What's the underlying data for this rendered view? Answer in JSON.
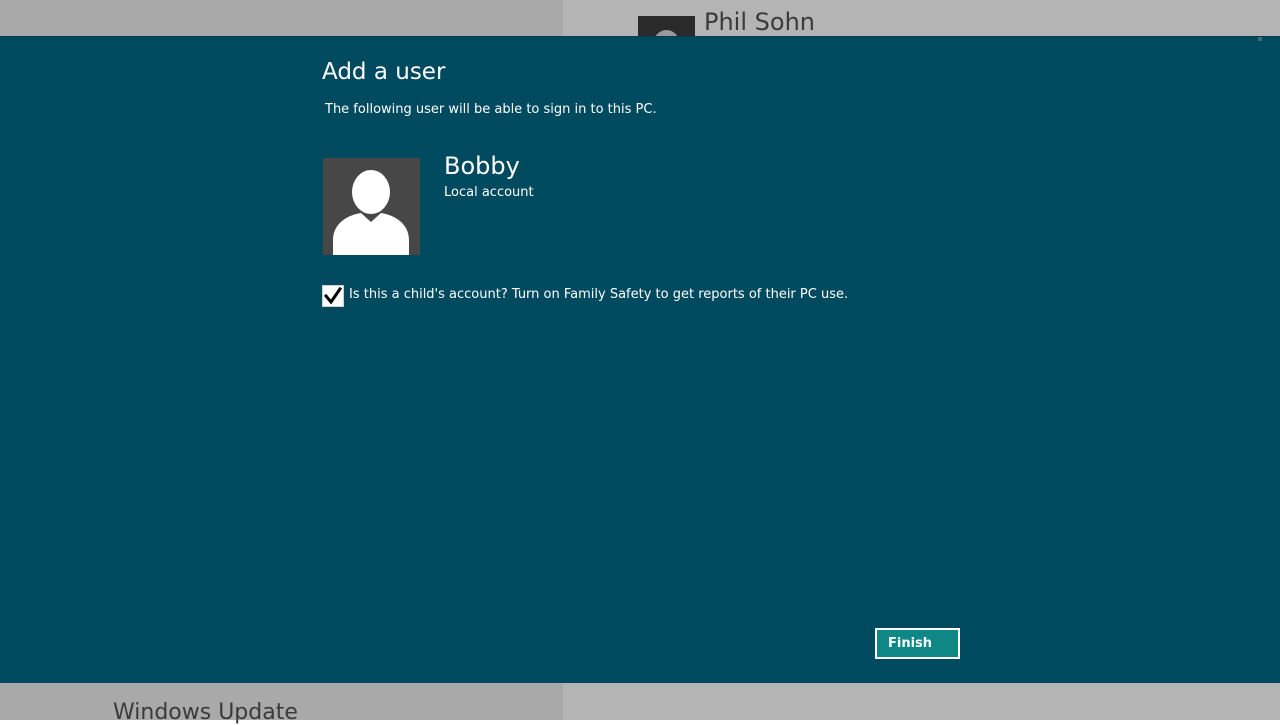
{
  "background": {
    "user_name": "Phil Sohn",
    "settings_item": "Windows Update"
  },
  "dialog": {
    "title": "Add a user",
    "subtitle": "The following user will be able to sign in to this PC.",
    "user": {
      "name": "Bobby",
      "account_type": "Local account"
    },
    "family_safety": {
      "checked": true,
      "label": "Is this a child's account? Turn on Family Safety to get reports of their PC use."
    },
    "finish_label": "Finish"
  },
  "colors": {
    "dialog_bg": "#004a60",
    "button_bg": "#0f8787",
    "avatar_bg": "#474747"
  },
  "icons": {
    "avatar": "user-silhouette-icon",
    "checkbox": "checkmark-icon"
  }
}
